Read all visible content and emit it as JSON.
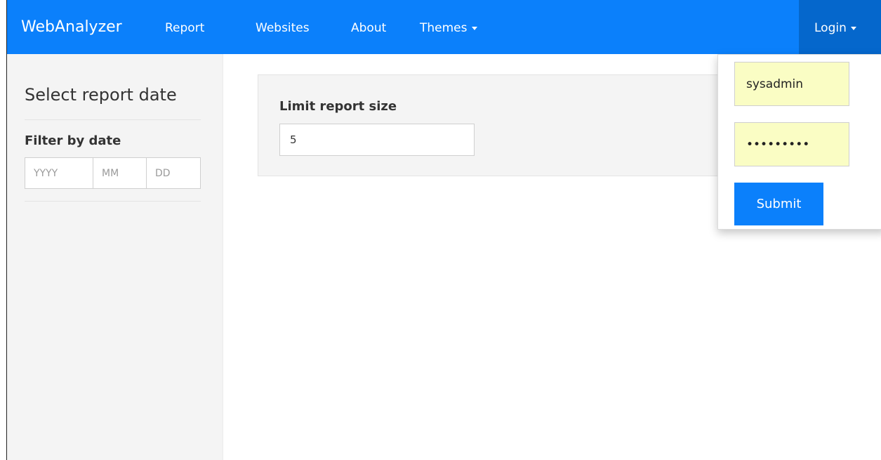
{
  "colors": {
    "navbar": "#0b80fb",
    "navbar_active": "#0567cc",
    "sidebar_bg": "#f4f4f4",
    "autofill_bg": "#fafdc4",
    "button_primary": "#0b80fb"
  },
  "navbar": {
    "brand": "WebAnalyzer",
    "items": [
      {
        "label": "Report"
      },
      {
        "label": "Websites"
      },
      {
        "label": "About"
      },
      {
        "label": "Themes",
        "icon": "caret-down-icon"
      }
    ],
    "login": {
      "label": "Login",
      "icon": "caret-down-icon"
    }
  },
  "sidebar": {
    "title": "Select report date",
    "filter_label": "Filter by date",
    "date_inputs": {
      "year": {
        "placeholder": "YYYY",
        "value": ""
      },
      "month": {
        "placeholder": "MM",
        "value": ""
      },
      "day": {
        "placeholder": "DD",
        "value": ""
      }
    }
  },
  "main": {
    "limit_label": "Limit report size",
    "limit_value": "5"
  },
  "login_dropdown": {
    "username": "sysadmin",
    "password": "•••••••••",
    "submit_label": "Submit"
  }
}
